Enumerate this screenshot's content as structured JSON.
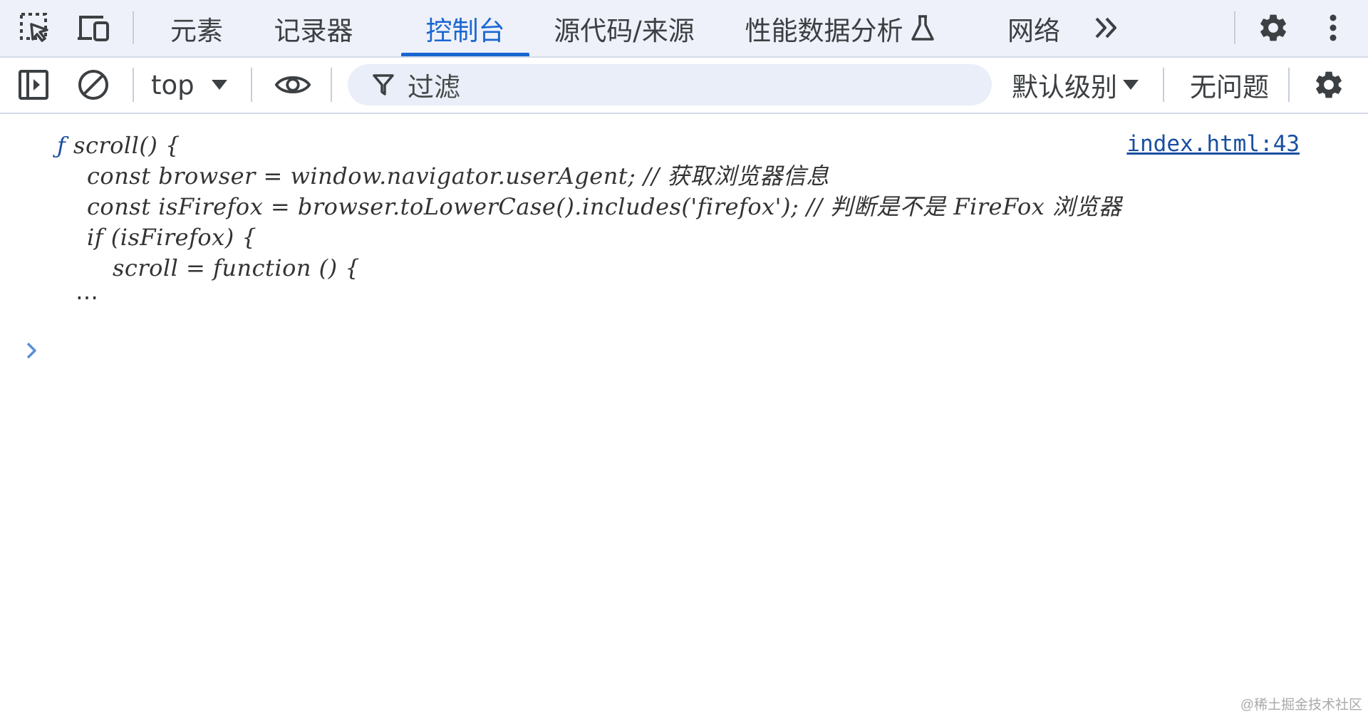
{
  "colors": {
    "tabbar_bg": "#eef1f9",
    "accent": "#1a66d2",
    "link": "#1a4fa0",
    "filter_bg": "#e9eef8"
  },
  "tabbar": {
    "icons": [
      "element-picker-icon",
      "device-toolbar-icon",
      "more-tabs-icon",
      "settings-gear-icon",
      "kebab-menu-icon",
      "flask-icon"
    ],
    "tabs": [
      {
        "label": "元素"
      },
      {
        "label": "记录器"
      },
      {
        "label": "控制台",
        "active": true
      },
      {
        "label": "源代码/来源"
      },
      {
        "label": "性能数据分析"
      },
      {
        "label": "网络"
      }
    ]
  },
  "toolbar": {
    "context": "top",
    "filter_placeholder": "过滤",
    "levels": "默认级别",
    "issues": "无问题",
    "icons": [
      "sidebar-toggle-icon",
      "clear-console-icon",
      "eye-icon",
      "filter-icon",
      "console-settings-icon"
    ]
  },
  "console": {
    "entry": {
      "f_symbol": "ƒ",
      "lines": [
        "scroll() {",
        "const browser = window.navigator.userAgent; // 获取浏览器信息",
        "const isFirefox = browser.toLowerCase().includes('firefox'); // 判断是不是 FireFox 浏览器",
        "if (isFirefox) {",
        "scroll = function () {"
      ],
      "ellipsis": "…",
      "source": "index.html:43"
    }
  },
  "watermark": "@稀土掘金技术社区"
}
